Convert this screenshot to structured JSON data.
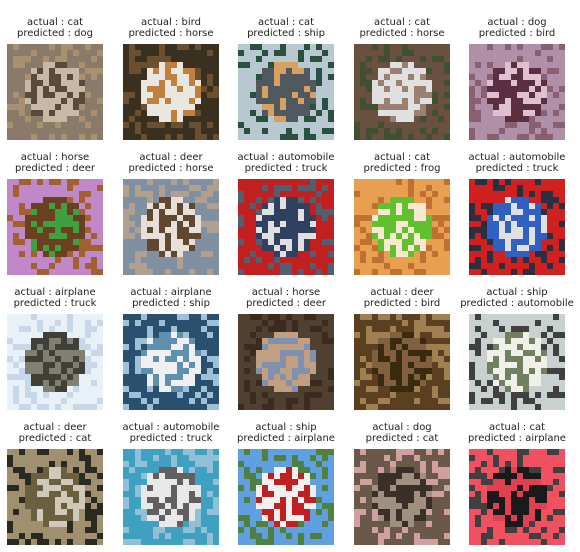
{
  "grid": {
    "rows": [
      [
        {
          "actual": "actual : cat",
          "predicted": "predicted : dog",
          "subject": "cat",
          "palette": [
            "#8a7a6a",
            "#c8b8a8",
            "#5a4a3a",
            "#a89070"
          ]
        },
        {
          "actual": "actual : bird",
          "predicted": "predicted : horse",
          "subject": "bird",
          "palette": [
            "#3a3020",
            "#e8e8e0",
            "#c08040",
            "#6a5030"
          ]
        },
        {
          "actual": "actual : cat",
          "predicted": "predicted : ship",
          "subject": "cat",
          "palette": [
            "#b8c8d0",
            "#505860",
            "#d8a060",
            "#2a5040"
          ]
        },
        {
          "actual": "actual : cat",
          "predicted": "predicted : horse",
          "subject": "cat",
          "palette": [
            "#6a5040",
            "#e0e0e0",
            "#9a8070",
            "#405030"
          ]
        },
        {
          "actual": "actual : dog",
          "predicted": "predicted : bird",
          "subject": "dog",
          "palette": [
            "#b090a8",
            "#5a3040",
            "#e0c0d0",
            "#8a6070"
          ]
        }
      ],
      [
        {
          "actual": "actual : horse",
          "predicted": "predicted : deer",
          "subject": "horse",
          "palette": [
            "#c088c8",
            "#6a4020",
            "#40a040",
            "#a06030"
          ]
        },
        {
          "actual": "actual : deer",
          "predicted": "predicted : horse",
          "subject": "deer",
          "palette": [
            "#8090a0",
            "#e8e0d8",
            "#604830",
            "#b0a090"
          ]
        },
        {
          "actual": "actual : automobile",
          "predicted": "predicted : truck",
          "subject": "automobile",
          "palette": [
            "#c02020",
            "#304060",
            "#e0e0e0",
            "#506070"
          ]
        },
        {
          "actual": "actual : cat",
          "predicted": "predicted : frog",
          "subject": "cat",
          "palette": [
            "#e8a050",
            "#60c030",
            "#f8e8d0",
            "#c07030"
          ]
        },
        {
          "actual": "actual : automobile",
          "predicted": "predicted : truck",
          "subject": "automobile",
          "palette": [
            "#d02020",
            "#3060c0",
            "#e0e0e0",
            "#2a3040"
          ]
        }
      ],
      [
        {
          "actual": "actual : airplane",
          "predicted": "predicted : truck",
          "subject": "airplane",
          "palette": [
            "#e8f0f8",
            "#404038",
            "#808070",
            "#c8d8e8"
          ]
        },
        {
          "actual": "actual : airplane",
          "predicted": "predicted : ship",
          "subject": "airplane",
          "palette": [
            "#2a5070",
            "#f0f0f0",
            "#6090b0",
            "#a0c0d8"
          ]
        },
        {
          "actual": "actual : horse",
          "predicted": "predicted : deer",
          "subject": "horse",
          "palette": [
            "#504030",
            "#c0a080",
            "#8090b0",
            "#3a2a20"
          ]
        },
        {
          "actual": "actual : deer",
          "predicted": "predicted : bird",
          "subject": "deer",
          "palette": [
            "#5a4020",
            "#806040",
            "#3a2a10",
            "#a08050"
          ]
        },
        {
          "actual": "actual : ship",
          "predicted": "predicted : automobile",
          "subject": "ship",
          "palette": [
            "#c8d0d0",
            "#f0f0e8",
            "#708060",
            "#404040"
          ]
        }
      ],
      [
        {
          "actual": "actual : deer",
          "predicted": "predicted : cat",
          "subject": "deer",
          "palette": [
            "#a09070",
            "#6a6040",
            "#d0c8b8",
            "#2a2a20"
          ]
        },
        {
          "actual": "actual : automobile",
          "predicted": "predicted : truck",
          "subject": "automobile",
          "palette": [
            "#40a0c0",
            "#e8e8e8",
            "#606060",
            "#90c0d8"
          ]
        },
        {
          "actual": "actual : ship",
          "predicted": "predicted : airplane",
          "subject": "ship",
          "palette": [
            "#60a0e0",
            "#f0f0f0",
            "#c02020",
            "#508040"
          ]
        },
        {
          "actual": "actual : dog",
          "predicted": "predicted : cat",
          "subject": "dog",
          "palette": [
            "#6a5848",
            "#3a3028",
            "#a09080",
            "#d0a0a0"
          ]
        },
        {
          "actual": "actual : cat",
          "predicted": "predicted : airplane",
          "subject": "cat",
          "palette": [
            "#f05060",
            "#1a1a1a",
            "#e04050",
            "#404040"
          ]
        }
      ]
    ]
  }
}
